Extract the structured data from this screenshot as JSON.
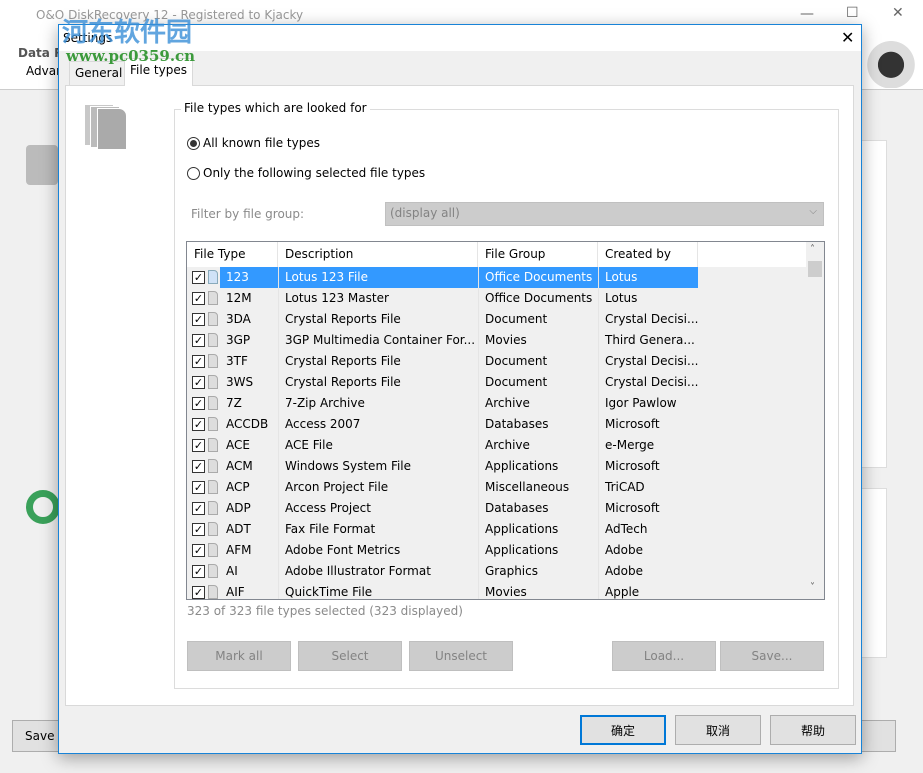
{
  "app": {
    "title": "O&O DiskRecovery 12 - Registered to Kjacky",
    "header_text_1": "Data R",
    "header_text_2": "Advan",
    "save_button": "Save c",
    "watermark_cn": "河东软件园",
    "watermark_url": "www.pc0359.cn"
  },
  "dialog": {
    "title": "Settings",
    "tabs": [
      "General",
      "File types"
    ],
    "active_tab": "File types",
    "group_label": "File types which are looked for",
    "radio_all": "All known file types",
    "radio_selected": "Only the following selected file types",
    "radio_value": "all",
    "filter_label": "Filter by file group:",
    "filter_value": "(display all)",
    "columns": [
      "File Type",
      "Description",
      "File Group",
      "Created by"
    ],
    "rows": [
      {
        "type": "123",
        "desc": "Lotus 123 File",
        "group": "Office Documents",
        "creator": "Lotus",
        "checked": true,
        "selected": true
      },
      {
        "type": "12M",
        "desc": "Lotus 123 Master",
        "group": "Office Documents",
        "creator": "Lotus",
        "checked": true
      },
      {
        "type": "3DA",
        "desc": "Crystal Reports File",
        "group": "Document",
        "creator": "Crystal Decisi...",
        "checked": true
      },
      {
        "type": "3GP",
        "desc": "3GP Multimedia Container For...",
        "group": "Movies",
        "creator": "Third Genera...",
        "checked": true
      },
      {
        "type": "3TF",
        "desc": "Crystal Reports File",
        "group": "Document",
        "creator": "Crystal Decisi...",
        "checked": true
      },
      {
        "type": "3WS",
        "desc": "Crystal Reports File",
        "group": "Document",
        "creator": "Crystal Decisi...",
        "checked": true
      },
      {
        "type": "7Z",
        "desc": "7-Zip Archive",
        "group": "Archive",
        "creator": "Igor Pawlow",
        "checked": true
      },
      {
        "type": "ACCDB",
        "desc": "Access 2007",
        "group": "Databases",
        "creator": "Microsoft",
        "checked": true
      },
      {
        "type": "ACE",
        "desc": "ACE File",
        "group": "Archive",
        "creator": "e-Merge",
        "checked": true
      },
      {
        "type": "ACM",
        "desc": "Windows System File",
        "group": "Applications",
        "creator": "Microsoft",
        "checked": true
      },
      {
        "type": "ACP",
        "desc": "Arcon Project File",
        "group": "Miscellaneous",
        "creator": "TriCAD",
        "checked": true
      },
      {
        "type": "ADP",
        "desc": "Access Project",
        "group": "Databases",
        "creator": "Microsoft",
        "checked": true
      },
      {
        "type": "ADT",
        "desc": "Fax File Format",
        "group": "Applications",
        "creator": "AdTech",
        "checked": true
      },
      {
        "type": "AFM",
        "desc": "Adobe Font Metrics",
        "group": "Applications",
        "creator": "Adobe",
        "checked": true
      },
      {
        "type": "AI",
        "desc": "Adobe Illustrator Format",
        "group": "Graphics",
        "creator": "Adobe",
        "checked": true
      },
      {
        "type": "AIF",
        "desc": "QuickTime File",
        "group": "Movies",
        "creator": "Apple",
        "checked": true
      }
    ],
    "status": "323 of 323 file types selected (323 displayed)",
    "buttons": {
      "mark_all": "Mark all",
      "select": "Select",
      "unselect": "Unselect",
      "load": "Load...",
      "save": "Save...",
      "ok": "确定",
      "cancel": "取消",
      "help": "帮助"
    }
  }
}
